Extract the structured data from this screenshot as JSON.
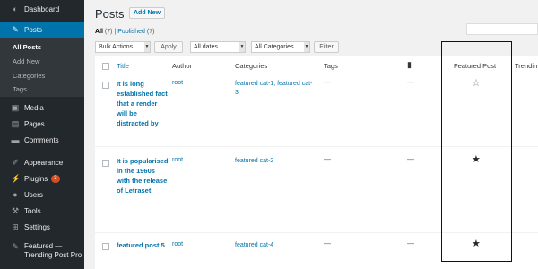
{
  "sidebar": {
    "items": [
      {
        "label": "Dashboard",
        "icon": "dashboard-icon",
        "glyph": "◐"
      },
      {
        "label": "Posts",
        "icon": "pin-icon",
        "glyph": "✎"
      },
      {
        "label": "Media",
        "icon": "media-icon",
        "glyph": "▣"
      },
      {
        "label": "Pages",
        "icon": "pages-icon",
        "glyph": "▤"
      },
      {
        "label": "Comments",
        "icon": "comments-icon",
        "glyph": "▬"
      },
      {
        "label": "Appearance",
        "icon": "brush-icon",
        "glyph": "✐"
      },
      {
        "label": "Plugins",
        "icon": "plug-icon",
        "glyph": "⚡",
        "badge": "3"
      },
      {
        "label": "Users",
        "icon": "users-icon",
        "glyph": "●"
      },
      {
        "label": "Tools",
        "icon": "wrench-icon",
        "glyph": "⚒"
      },
      {
        "label": "Settings",
        "icon": "settings-icon",
        "glyph": "⊞"
      },
      {
        "label": "Featured —",
        "label2": "Trending Post Pro",
        "icon": "pin-icon",
        "glyph": "✎"
      }
    ],
    "submenu": [
      "All Posts",
      "Add New",
      "Categories",
      "Tags"
    ]
  },
  "header": {
    "title": "Posts",
    "add_new": "Add New",
    "filter_all": "All",
    "filter_all_count": "(7)",
    "separator": "|",
    "filter_published": "Published",
    "filter_published_count": "(7)"
  },
  "toolbar": {
    "bulk_actions": "Bulk Actions",
    "apply": "Apply",
    "all_dates": "All dates",
    "all_categories": "All Categories",
    "filter": "Filter"
  },
  "table": {
    "headers": {
      "title": "Title",
      "author": "Author",
      "categories": "Categories",
      "tags": "Tags",
      "comments_icon": "comment-bubble-icon",
      "featured": "Featured Post",
      "trending": "Trendin"
    },
    "rows": [
      {
        "title": "It is long established fact that a render will be distracted by",
        "author": "root",
        "categories": "featured cat-1, featured cat-3",
        "tags": "—",
        "comments": "—",
        "featured": false
      },
      {
        "title": "It is popularised in the 1960s with the release of Letraset",
        "author": "root",
        "categories": "featured cat-2",
        "tags": "—",
        "comments": "—",
        "featured": true
      },
      {
        "title": "featured post 5",
        "author": "root",
        "categories": "featured cat-4",
        "tags": "—",
        "comments": "—",
        "featured": true
      }
    ],
    "star_filled": "★",
    "star_empty": "☆"
  }
}
